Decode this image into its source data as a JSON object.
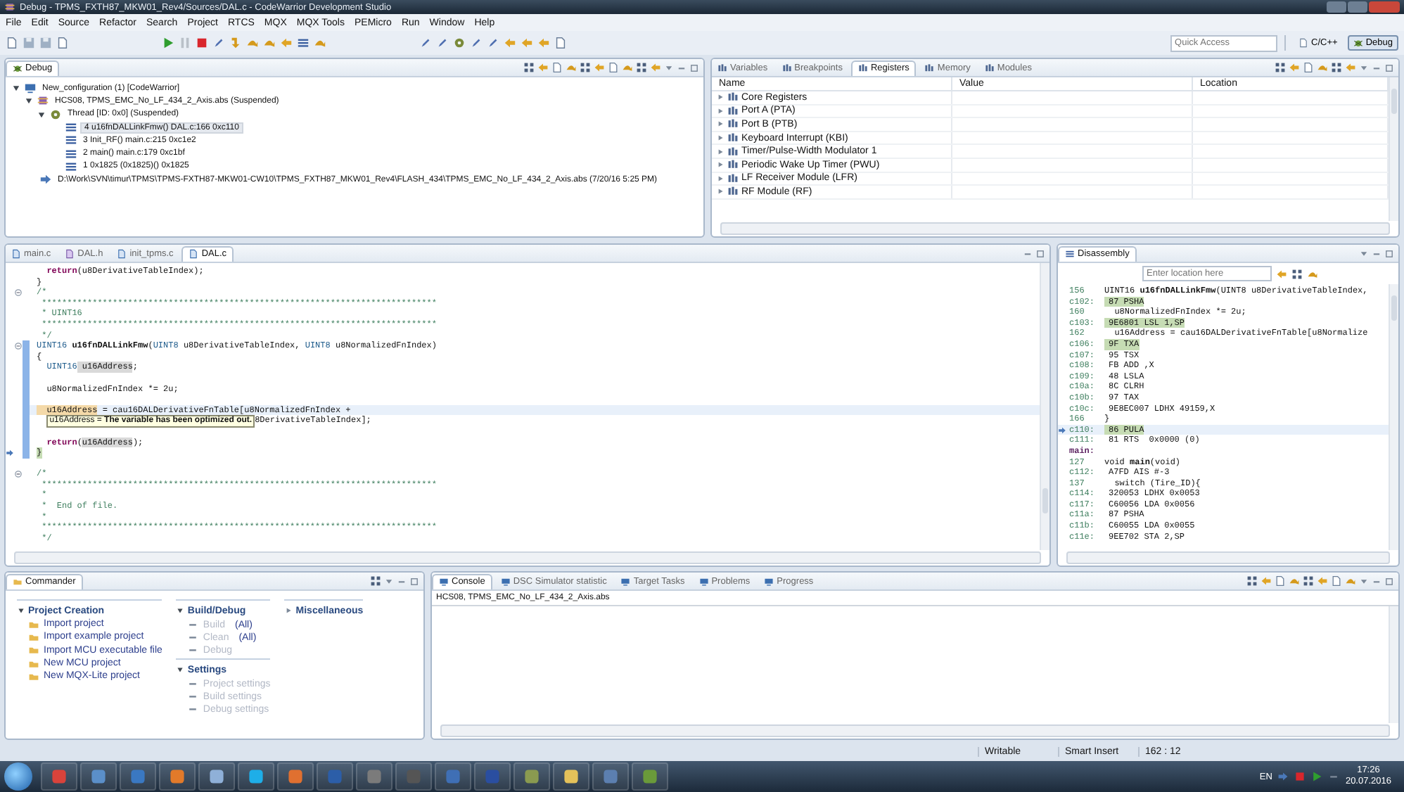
{
  "window": {
    "title": "Debug - TPMS_FXTH87_MKW01_Rev4/Sources/DAL.c - CodeWarrior Development Studio"
  },
  "menu": [
    "File",
    "Edit",
    "Source",
    "Refactor",
    "Search",
    "Project",
    "RTCS",
    "MQX",
    "MQX Tools",
    "PEMicro",
    "Run",
    "Window",
    "Help"
  ],
  "toolbar": {
    "quick_access": {
      "placeholder": "Quick Access"
    },
    "perspectives": [
      {
        "label": "C/C++",
        "selected": false
      },
      {
        "label": "Debug",
        "selected": true
      }
    ]
  },
  "debug_view": {
    "tab": "Debug",
    "tree": [
      {
        "label": "New_configuration (1) [CodeWarrior]",
        "kind": "config",
        "expanded": true,
        "selected": false,
        "children": [
          {
            "label": "HCS08, TPMS_EMC_No_LF_434_2_Axis.abs (Suspended)",
            "kind": "target",
            "expanded": true,
            "selected": false,
            "children": [
              {
                "label": "Thread [ID: 0x0] (Suspended)",
                "kind": "thread",
                "expanded": true,
                "selected": false,
                "children": [
                  {
                    "label": "4 u16fnDALLinkFmw() DAL.c:166 0xc110",
                    "kind": "frame",
                    "selected": true
                  },
                  {
                    "label": "3 Init_RF() main.c:215 0xc1e2",
                    "kind": "frame",
                    "selected": false
                  },
                  {
                    "label": "2 main() main.c:179 0xc1bf",
                    "kind": "frame",
                    "selected": false
                  },
                  {
                    "label": "1 0x1825 (0x1825)() 0x1825",
                    "kind": "frame",
                    "selected": false
                  }
                ]
              }
            ]
          },
          {
            "label": "D:\\Work\\SVN\\timur\\TPMS\\TPMS-FXTH87-MKW01-CW10\\TPMS_FXTH87_MKW01_Rev4\\FLASH_434\\TPMS_EMC_No_LF_434_2_Axis.abs (7/20/16 5:25 PM)",
            "kind": "process",
            "selected": false
          }
        ]
      }
    ]
  },
  "registers_view": {
    "tabs": [
      {
        "label": "Variables",
        "selected": false
      },
      {
        "label": "Breakpoints",
        "selected": false
      },
      {
        "label": "Registers",
        "selected": true
      },
      {
        "label": "Memory",
        "selected": false
      },
      {
        "label": "Modules",
        "selected": false
      }
    ],
    "columns": [
      "Name",
      "Value",
      "Location"
    ],
    "rows": [
      {
        "name": "Core Registers",
        "expanded": false
      },
      {
        "name": "Port A (PTA)",
        "expanded": false
      },
      {
        "name": "Port B (PTB)",
        "expanded": false
      },
      {
        "name": "Keyboard Interrupt (KBI)",
        "expanded": false
      },
      {
        "name": "Timer/Pulse-Width Modulator 1",
        "expanded": false
      },
      {
        "name": "Periodic Wake Up Timer (PWU)",
        "expanded": false
      },
      {
        "name": "LF Receiver Module (LFR)",
        "expanded": false
      },
      {
        "name": "RF Module (RF)",
        "expanded": false
      }
    ]
  },
  "editor": {
    "tabs": [
      {
        "label": "main.c",
        "kind": "c",
        "selected": false
      },
      {
        "label": "DAL.h",
        "kind": "h",
        "selected": false
      },
      {
        "label": "init_tpms.c",
        "kind": "c",
        "selected": false
      },
      {
        "label": "DAL.c",
        "kind": "c",
        "selected": true
      }
    ],
    "lines": [
      {
        "foldable": false,
        "current_instruction": false,
        "range": false,
        "cursor": false,
        "segs": [
          {
            "kind": "keyword",
            "text": "  return"
          },
          {
            "kind": "plain",
            "text": "(u8DerivativeTableIndex);"
          }
        ]
      },
      {
        "foldable": false,
        "current_instruction": false,
        "range": false,
        "cursor": false,
        "segs": [
          {
            "kind": "plain",
            "text": "}"
          }
        ]
      },
      {
        "foldable": true,
        "current_instruction": false,
        "range": false,
        "cursor": false,
        "segs": [
          {
            "kind": "comment",
            "text": "/*"
          }
        ]
      },
      {
        "foldable": false,
        "current_instruction": false,
        "range": false,
        "cursor": false,
        "segs": [
          {
            "kind": "comment",
            "text": " ******************************************************************************"
          }
        ]
      },
      {
        "foldable": false,
        "current_instruction": false,
        "range": false,
        "cursor": false,
        "segs": [
          {
            "kind": "comment",
            "text": " * UINT16"
          }
        ]
      },
      {
        "foldable": false,
        "current_instruction": false,
        "range": false,
        "cursor": false,
        "segs": [
          {
            "kind": "comment",
            "text": " ******************************************************************************"
          }
        ]
      },
      {
        "foldable": false,
        "current_instruction": false,
        "range": false,
        "cursor": false,
        "segs": [
          {
            "kind": "comment",
            "text": " */"
          }
        ]
      },
      {
        "foldable": true,
        "current_instruction": false,
        "range": true,
        "cursor": false,
        "segs": [
          {
            "kind": "type",
            "text": "UINT16"
          },
          {
            "kind": "function",
            "text": " u16fnDALLinkFmw"
          },
          {
            "kind": "plain",
            "text": "("
          },
          {
            "kind": "type",
            "text": "UINT8"
          },
          {
            "kind": "plain",
            "text": " u8DerivativeTableIndex, "
          },
          {
            "kind": "type",
            "text": "UINT8"
          },
          {
            "kind": "plain",
            "text": " u8NormalizedFnIndex)"
          }
        ]
      },
      {
        "foldable": false,
        "current_instruction": false,
        "range": true,
        "cursor": false,
        "segs": [
          {
            "kind": "plain",
            "text": "{"
          }
        ]
      },
      {
        "foldable": false,
        "current_instruction": false,
        "range": true,
        "cursor": false,
        "segs": [
          {
            "kind": "type",
            "text": "  UINT16"
          },
          {
            "kind": "occurrence",
            "text": " u16Address"
          },
          {
            "kind": "plain",
            "text": ";"
          }
        ]
      },
      {
        "foldable": false,
        "current_instruction": false,
        "range": true,
        "cursor": false
      },
      {
        "foldable": false,
        "current_instruction": false,
        "range": true,
        "cursor": false,
        "segs": [
          {
            "kind": "plain",
            "text": "  u8NormalizedFnIndex *= 2u;"
          }
        ]
      },
      {
        "foldable": false,
        "current_instruction": false,
        "range": true,
        "cursor": false
      },
      {
        "foldable": false,
        "current_instruction": false,
        "range": true,
        "cursor": true,
        "segs": [
          {
            "kind": "selection",
            "text": "  u16Address"
          },
          {
            "kind": "plain",
            "text": " = cau16DALDerivativeFnTable[u8NormalizedFnIndex +"
          }
        ]
      },
      {
        "foldable": false,
        "current_instruction": false,
        "range": true,
        "cursor": false,
        "tooltip": "u16Address = **The variable has been optimized out.**",
        "segs": [
          {
            "kind": "plain",
            "text": "8DerivativeTableIndex];"
          }
        ]
      },
      {
        "foldable": false,
        "current_instruction": false,
        "range": true,
        "cursor": false
      },
      {
        "foldable": false,
        "current_instruction": false,
        "range": true,
        "cursor": false,
        "segs": [
          {
            "kind": "keyword",
            "text": "  return"
          },
          {
            "kind": "plain",
            "text": "("
          },
          {
            "kind": "occurrence",
            "text": "u16Address"
          },
          {
            "kind": "plain",
            "text": ");"
          }
        ]
      },
      {
        "foldable": false,
        "current_instruction": true,
        "range": true,
        "cursor": false,
        "segs": [
          {
            "kind": "plain",
            "text": "}"
          }
        ]
      },
      {
        "foldable": false,
        "current_instruction": false,
        "range": false,
        "cursor": false
      },
      {
        "foldable": true,
        "current_instruction": false,
        "range": false,
        "cursor": false,
        "segs": [
          {
            "kind": "comment",
            "text": "/*"
          }
        ]
      },
      {
        "foldable": false,
        "current_instruction": false,
        "range": false,
        "cursor": false,
        "segs": [
          {
            "kind": "comment",
            "text": " ******************************************************************************"
          }
        ]
      },
      {
        "foldable": false,
        "current_instruction": false,
        "range": false,
        "cursor": false,
        "segs": [
          {
            "kind": "comment",
            "text": " *"
          }
        ]
      },
      {
        "foldable": false,
        "current_instruction": false,
        "range": false,
        "cursor": false,
        "segs": [
          {
            "kind": "comment",
            "text": " *  End of file."
          }
        ]
      },
      {
        "foldable": false,
        "current_instruction": false,
        "range": false,
        "cursor": false,
        "segs": [
          {
            "kind": "comment",
            "text": " *"
          }
        ]
      },
      {
        "foldable": false,
        "current_instruction": false,
        "range": false,
        "cursor": false,
        "segs": [
          {
            "kind": "comment",
            "text": " ******************************************************************************"
          }
        ]
      },
      {
        "foldable": false,
        "current_instruction": false,
        "range": false,
        "cursor": false,
        "segs": [
          {
            "kind": "comment",
            "text": " */"
          }
        ]
      }
    ]
  },
  "disassembly": {
    "tab": "Disassembly",
    "location": {
      "placeholder": "Enter location here"
    },
    "rows": [
      {
        "kind": "source",
        "addr": "156",
        "text": "UINT16 **u16fnDALLinkFmw**(UINT8 u8DerivativeTableIndex,"
      },
      {
        "kind": "instr",
        "addr": "c102:",
        "text": "87 PSHA",
        "executed": true,
        "current": false
      },
      {
        "kind": "source",
        "addr": "160",
        "text": "  u8NormalizedFnIndex *= 2u;"
      },
      {
        "kind": "instr",
        "addr": "c103:",
        "text": "9E6801 LSL 1,SP",
        "executed": true,
        "current": false
      },
      {
        "kind": "source",
        "addr": "162",
        "text": "  u16Address = cau16DALDerivativeFnTable[u8Normalize"
      },
      {
        "kind": "instr",
        "addr": "c106:",
        "text": "9F TXA",
        "executed": true,
        "current": false
      },
      {
        "kind": "instr",
        "addr": "c107:",
        "text": "95 TSX",
        "executed": false,
        "current": false
      },
      {
        "kind": "instr",
        "addr": "c108:",
        "text": "FB ADD ,X",
        "executed": false,
        "current": false
      },
      {
        "kind": "instr",
        "addr": "c109:",
        "text": "48 LSLA",
        "executed": false,
        "current": false
      },
      {
        "kind": "instr",
        "addr": "c10a:",
        "text": "8C CLRH",
        "executed": false,
        "current": false
      },
      {
        "kind": "instr",
        "addr": "c10b:",
        "text": "97 TAX",
        "executed": false,
        "current": false
      },
      {
        "kind": "instr",
        "addr": "c10c:",
        "text": "9E8EC007 LDHX 49159,X",
        "executed": false,
        "current": false
      },
      {
        "kind": "source",
        "addr": "166",
        "text": "}"
      },
      {
        "kind": "instr",
        "addr": "c110:",
        "text": "86 PULA",
        "executed": true,
        "current": true
      },
      {
        "kind": "instr",
        "addr": "c111:",
        "text": "81 RTS  0x0000 (0)",
        "executed": false,
        "current": false
      },
      {
        "kind": "label",
        "text": "main:"
      },
      {
        "kind": "source",
        "addr": "127",
        "text": "void **main**(void)"
      },
      {
        "kind": "instr",
        "addr": "c112:",
        "text": "A7FD AIS #-3",
        "executed": false,
        "current": false
      },
      {
        "kind": "source",
        "addr": "137",
        "text": "  switch (Tire_ID){"
      },
      {
        "kind": "instr",
        "addr": "c114:",
        "text": "320053 LDHX 0x0053",
        "executed": false,
        "current": false
      },
      {
        "kind": "instr",
        "addr": "c117:",
        "text": "C60056 LDA 0x0056",
        "executed": false,
        "current": false
      },
      {
        "kind": "instr",
        "addr": "c11a:",
        "text": "87 PSHA",
        "executed": false,
        "current": false
      },
      {
        "kind": "instr",
        "addr": "c11b:",
        "text": "C60055 LDA 0x0055",
        "executed": false,
        "current": false
      },
      {
        "kind": "instr",
        "addr": "c11e:",
        "text": "9EE702 STA 2,SP",
        "executed": false,
        "current": false
      }
    ]
  },
  "commander": {
    "tab": "Commander",
    "sections": [
      {
        "title": "Project Creation",
        "expanded": true,
        "items": [
          {
            "label": "Import project",
            "disabled": false
          },
          {
            "label": "Import example project",
            "disabled": false
          },
          {
            "label": "Import MCU executable file",
            "disabled": false
          },
          {
            "label": "New MCU project",
            "disabled": false
          },
          {
            "label": "New MQX-Lite project",
            "disabled": false
          }
        ]
      },
      {
        "title": "Build/Debug",
        "expanded": true,
        "items": [
          {
            "label": "Build",
            "suffix": "(All)",
            "disabled": true
          },
          {
            "label": "Clean",
            "suffix": "(All)",
            "disabled": true
          },
          {
            "label": "Debug",
            "disabled": true
          }
        ]
      },
      {
        "title": "Settings",
        "expanded": true,
        "items": [
          {
            "label": "Project settings",
            "disabled": true
          },
          {
            "label": "Build settings",
            "disabled": true
          },
          {
            "label": "Debug settings",
            "disabled": true
          }
        ]
      },
      {
        "title": "Miscellaneous",
        "expanded": false
      }
    ]
  },
  "console_view": {
    "tabs": [
      {
        "label": "Console",
        "selected": true
      },
      {
        "label": "DSC Simulator statistic",
        "selected": false
      },
      {
        "label": "Target Tasks",
        "selected": false
      },
      {
        "label": "Problems",
        "selected": false
      },
      {
        "label": "Progress",
        "selected": false
      }
    ],
    "header": "HCS08, TPMS_EMC_No_LF_434_2_Axis.abs"
  },
  "status_bar": [
    "Writable",
    "Smart Insert",
    "162 : 12"
  ],
  "taskbar": {
    "language": "EN",
    "time": "17:26",
    "date": "20.07.2016"
  }
}
